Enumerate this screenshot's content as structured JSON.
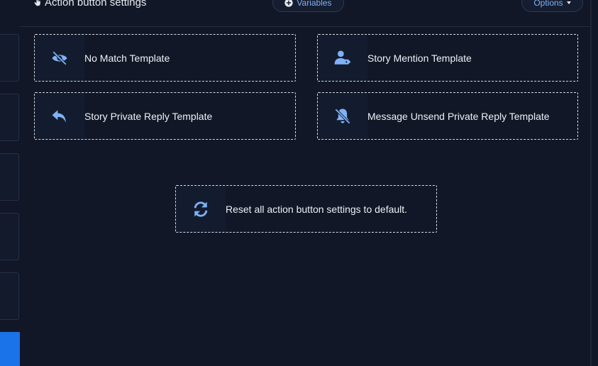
{
  "header": {
    "title": "Action button settings",
    "variables_label": "Variables",
    "options_label": "Options"
  },
  "actions": [
    {
      "label": "No Match Template",
      "icon": "eye-slash-icon"
    },
    {
      "label": "Story Mention Template",
      "icon": "user-tag-icon"
    },
    {
      "label": "Story Private Reply Template",
      "icon": "reply-icon"
    },
    {
      "label": "Message Unsend Private Reply Template",
      "icon": "bell-slash-icon"
    }
  ],
  "reset": {
    "label": "Reset all action button settings to default.",
    "icon": "sync-icon"
  },
  "colors": {
    "background": "#111727",
    "accent": "#7fb2f5",
    "sidebar_active": "#1a73e8"
  }
}
